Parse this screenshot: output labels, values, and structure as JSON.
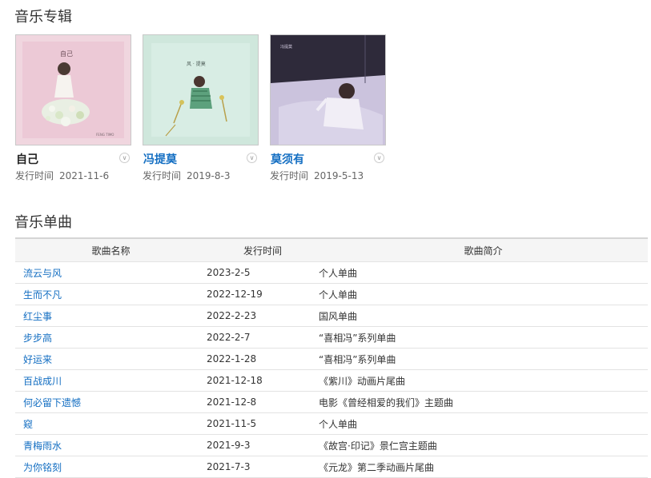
{
  "albums_title": "音乐专辑",
  "singles_title": "音乐单曲",
  "albums": [
    {
      "name": "自己",
      "date_label": "发行时间",
      "date": "2021-11-6"
    },
    {
      "name": "冯提莫",
      "date_label": "发行时间",
      "date": "2019-8-3"
    },
    {
      "name": "莫须有",
      "date_label": "发行时间",
      "date": "2019-5-13"
    }
  ],
  "singles_table": {
    "headers": [
      "歌曲名称",
      "发行时间",
      "歌曲简介"
    ],
    "rows": [
      {
        "name": "流云与风",
        "date": "2023-2-5",
        "desc": "个人单曲"
      },
      {
        "name": "生而不凡",
        "date": "2022-12-19",
        "desc": "个人单曲"
      },
      {
        "name": "红尘事",
        "date": "2022-2-23",
        "desc": "国风单曲"
      },
      {
        "name": "步步高",
        "date": "2022-2-7",
        "desc": "“喜相冯”系列单曲"
      },
      {
        "name": "好运来",
        "date": "2022-1-28",
        "desc": "“喜相冯”系列单曲"
      },
      {
        "name": "百战成川",
        "date": "2021-12-18",
        "desc": "《紫川》动画片尾曲"
      },
      {
        "name": "何必留下遗憾",
        "date": "2021-12-8",
        "desc": "电影《曾经相爱的我们》主题曲"
      },
      {
        "name": "窥",
        "date": "2021-11-5",
        "desc": "个人单曲"
      },
      {
        "name": "青梅雨水",
        "date": "2021-9-3",
        "desc": "《故宫·印记》景仁宫主题曲"
      },
      {
        "name": "为你铭刻",
        "date": "2021-7-3",
        "desc": "《元龙》第二季动画片尾曲"
      }
    ]
  }
}
